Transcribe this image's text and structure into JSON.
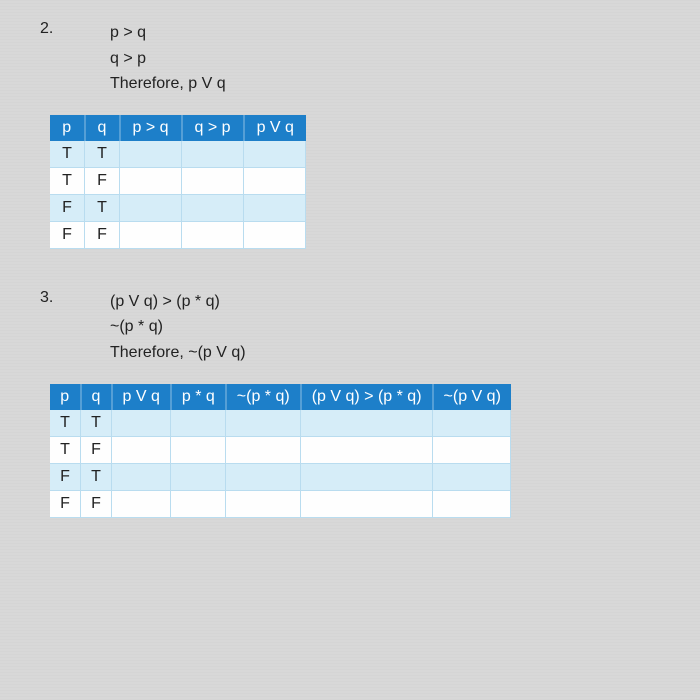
{
  "problem2": {
    "number": "2.",
    "lines": [
      "p > q",
      "q > p",
      "Therefore, p V q"
    ],
    "headers": [
      "p",
      "q",
      "p > q",
      "q > p",
      "p V q"
    ],
    "rows": [
      [
        "T",
        "T",
        "",
        "",
        ""
      ],
      [
        "T",
        "F",
        "",
        "",
        ""
      ],
      [
        "F",
        "T",
        "",
        "",
        ""
      ],
      [
        "F",
        "F",
        "",
        "",
        ""
      ]
    ]
  },
  "problem3": {
    "number": "3.",
    "lines": [
      "(p V q) > (p * q)",
      "~(p * q)",
      "Therefore, ~(p V q)"
    ],
    "headers": [
      "p",
      "q",
      "p V q",
      "p * q",
      "~(p * q)",
      "(p V q) > (p * q)",
      "~(p V q)"
    ],
    "rows": [
      [
        "T",
        "T",
        "",
        "",
        "",
        "",
        ""
      ],
      [
        "T",
        "F",
        "",
        "",
        "",
        "",
        ""
      ],
      [
        "F",
        "T",
        "",
        "",
        "",
        "",
        ""
      ],
      [
        "F",
        "F",
        "",
        "",
        "",
        "",
        ""
      ]
    ]
  }
}
